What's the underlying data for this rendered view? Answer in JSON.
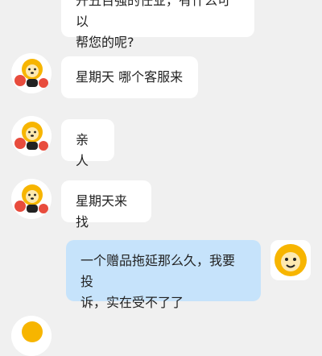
{
  "messages": [
    {
      "id": "m0",
      "sender": "agent",
      "text": "开丑百强的任业，有什么可以帮您的呢?",
      "partial_top": "开丑百强的任业，有什么可以",
      "line2": "帮您的呢?"
    },
    {
      "id": "m1",
      "sender": "user",
      "text": "星期天  哪个客服来"
    },
    {
      "id": "m2",
      "sender": "user",
      "text": "亲人"
    },
    {
      "id": "m3",
      "sender": "user",
      "text": "星期天来找"
    },
    {
      "id": "m4",
      "sender": "agent",
      "line1": "一个赠品拖延那么久，我要投",
      "line2": "诉，实在受不了了"
    }
  ],
  "colors": {
    "background": "#f0f0f0",
    "received_bubble": "#ffffff",
    "sent_bubble": "#c6e3fb",
    "lion_yellow": "#f7b500"
  }
}
